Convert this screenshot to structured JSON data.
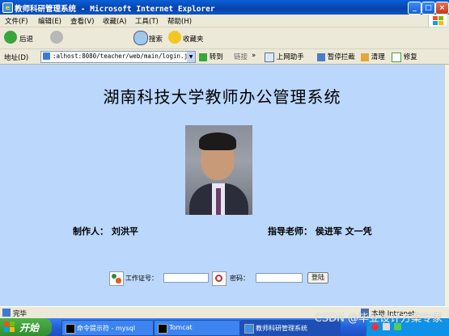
{
  "window": {
    "title": "教师科研管理系统 - Microsoft Internet Explorer"
  },
  "menu": [
    "文件(F)",
    "编辑(E)",
    "查看(V)",
    "收藏(A)",
    "工具(T)",
    "帮助(H)"
  ],
  "toolbar": {
    "back": "后退",
    "search": "搜索",
    "favorites": "收藏夹"
  },
  "address": {
    "label": "地址(D)",
    "url": ":alhost:8080/teacher/web/main/login.jsp",
    "go": "转到",
    "links": "链接",
    "online_assistant": "上网助手",
    "block": "暂停拦截",
    "clean": "清理",
    "repair": "修复"
  },
  "page": {
    "heading": "湖南科技大学教师办公管理系统",
    "author": "制作人：  刘洪平",
    "advisor": "指导老师：  侯进军  文一凭",
    "login": {
      "id_label": "工作证号：",
      "id_value": "",
      "password_label": "密码：",
      "password_value": "",
      "submit": "登陆"
    }
  },
  "status": {
    "text": "完毕",
    "zone": "本地 Intranet"
  },
  "taskbar": {
    "start": "开始",
    "tasks": [
      "命令提示符 - mysql",
      "Tomcat",
      "教师科研管理系统"
    ]
  },
  "watermark": "CSDN @毕业设计方案专家",
  "colors": {
    "page_bg": "#bbd7fc",
    "titlebar": "#0a56c8",
    "chrome": "#ece9d8"
  }
}
